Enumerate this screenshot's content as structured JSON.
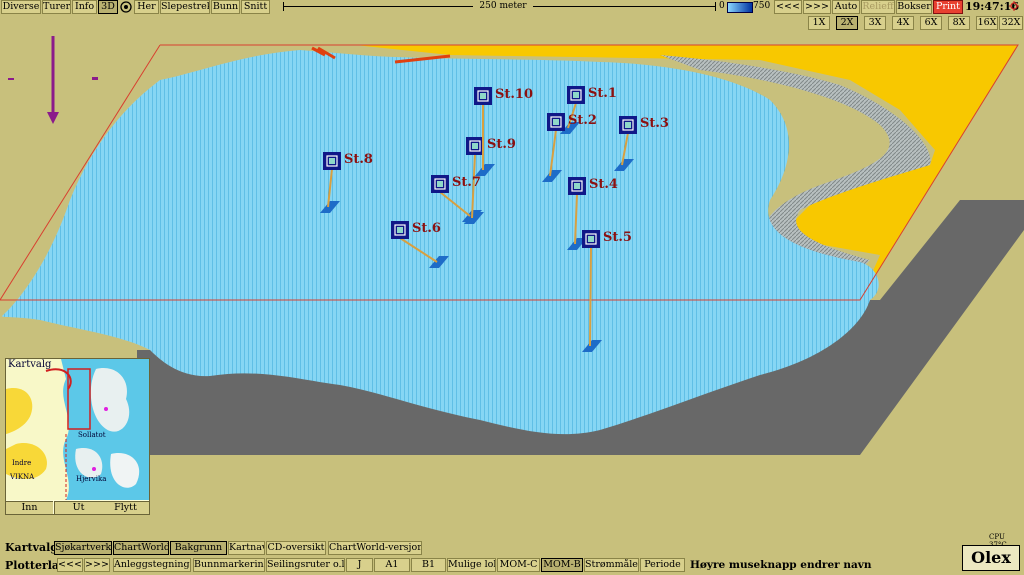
{
  "toolbar": {
    "diverse": "Diverse",
    "turer": "Turer",
    "info": "Info",
    "view3d": "3D",
    "her": "Her",
    "slepestrek": "Slepestrek",
    "bunn": "Bunn",
    "snitt": "Snitt",
    "scale_label": "250 meter",
    "depth_min": "0",
    "depth_max": "750",
    "prev": "<<<",
    "next": ">>>",
    "auto": "Auto",
    "relieff": "Relieff",
    "bokser": "Bokser",
    "print": "Print",
    "clock": "19:47:16"
  },
  "zoom_buttons": [
    "1X",
    "2X",
    "3X",
    "4X",
    "6X",
    "8X",
    "16X",
    "32X"
  ],
  "zoom_selected": "2X",
  "stations": [
    {
      "label": "St.1"
    },
    {
      "label": "St.2"
    },
    {
      "label": "St.3"
    },
    {
      "label": "St.4"
    },
    {
      "label": "St.5"
    },
    {
      "label": "St.6"
    },
    {
      "label": "St.7"
    },
    {
      "label": "St.8"
    },
    {
      "label": "St.9"
    },
    {
      "label": "St.10"
    }
  ],
  "minimap": {
    "title": "Kartvalg",
    "labels": [
      "Indre",
      "VIKNA",
      "Hjervika",
      "Sollatot"
    ],
    "inn": "Inn",
    "ut": "Ut",
    "flytt": "Flytt"
  },
  "kartvalg_row": {
    "label": "Kartvalg",
    "items": [
      "Sjøkartverket",
      "ChartWorld",
      "Bakgrunn",
      "Kartnavn",
      "CD-oversikt",
      "ChartWorld-versjoner"
    ]
  },
  "plotterlag_row": {
    "label": "Plotterlag",
    "items": [
      "<<<",
      ">>>",
      "Anleggstegninger",
      "Bunnmarkeringer",
      "Seilingsruter o.l.",
      "J",
      "A1",
      "B1",
      "Mulige lok",
      "MOM-C",
      "MOM-B",
      "Strømmåler",
      "Periode"
    ],
    "hint": "Høyre museknapp endrer navn"
  },
  "cpu": "CPU 37°C",
  "logo": "Olex",
  "colors": {
    "sea": "#7fd4f4",
    "land": "#f8c800",
    "grid": "#5a5a5a",
    "station": "#101888",
    "label": "#8b1010"
  }
}
